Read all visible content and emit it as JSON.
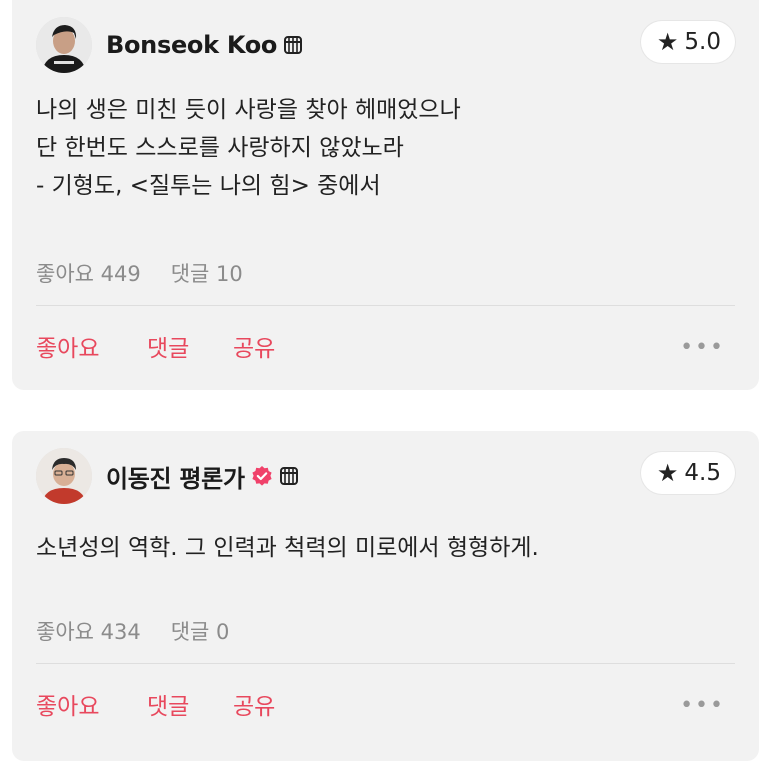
{
  "reviews": [
    {
      "author": "Bonseok Koo",
      "verified": false,
      "rating": "5.0",
      "lines": [
        "나의 생은 미친 듯이 사랑을 찾아 헤매었으나",
        "단 한번도 스스로를 사랑하지 않았노라",
        "- 기형도, <질투는 나의 힘> 중에서"
      ],
      "likes_text": "좋아요 449",
      "comments_text": "댓글 10"
    },
    {
      "author": "이동진 평론가",
      "verified": true,
      "rating": "4.5",
      "lines": [
        "소년성의 역학. 그 인력과 척력의 미로에서 형형하게."
      ],
      "likes_text": "좋아요 434",
      "comments_text": "댓글 0"
    }
  ],
  "actions": {
    "like": "좋아요",
    "comment": "댓글",
    "share": "공유",
    "more": "•••"
  },
  "icons": {
    "star": "★",
    "verified_color": "#f0416a",
    "accent_color": "#e8485d"
  }
}
